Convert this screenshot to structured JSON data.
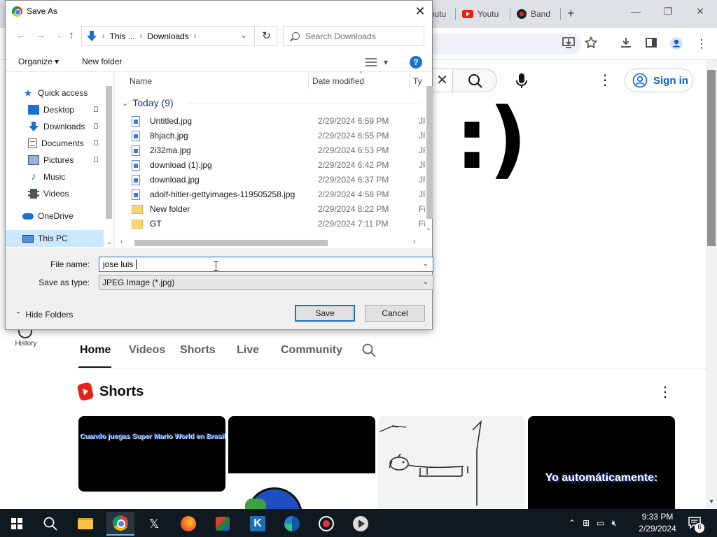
{
  "chrome": {
    "tabs": [
      {
        "label": "outu"
      },
      {
        "label": "Youtu"
      },
      {
        "label": "Band"
      }
    ],
    "new_tab": "+",
    "minimize": "—",
    "restore": "❐",
    "close": "✕"
  },
  "youtube": {
    "search_clear": "✕",
    "sign_in": "Sign in",
    "banner_text": ":)",
    "history_label": "History",
    "channel_tabs": [
      "Home",
      "Videos",
      "Shorts",
      "Live",
      "Community"
    ],
    "shorts_title": "Shorts",
    "shorts_more": "⋮",
    "shorts": [
      {
        "caption": "Cuando juegas Super Mario World en Brasil"
      },
      {
        "caption": ""
      },
      {
        "caption": ""
      },
      {
        "caption": "Yo automáticamente:"
      }
    ]
  },
  "dialog": {
    "title": "Save As",
    "close": "✕",
    "address": {
      "segments": [
        "This ...",
        "Downloads"
      ]
    },
    "search_placeholder": "Search Downloads",
    "organize": "Organize ▾",
    "new_folder": "New folder",
    "help": "?",
    "nav_items": [
      {
        "label": "Quick access",
        "icon": "star-icon"
      },
      {
        "label": "Desktop",
        "icon": "desktop-icon",
        "pinned": true
      },
      {
        "label": "Downloads",
        "icon": "download-icon",
        "pinned": true
      },
      {
        "label": "Documents",
        "icon": "document-icon",
        "pinned": true
      },
      {
        "label": "Pictures",
        "icon": "pictures-icon",
        "pinned": true
      },
      {
        "label": "Music",
        "icon": "music-icon"
      },
      {
        "label": "Videos",
        "icon": "videos-icon"
      },
      {
        "label": "OneDrive",
        "icon": "cloud-icon"
      },
      {
        "label": "This PC",
        "icon": "computer-icon",
        "selected": true
      }
    ],
    "columns": {
      "name": "Name",
      "date": "Date modified",
      "type": "Ty"
    },
    "group_label": "Today (9)",
    "files": [
      {
        "name": "Untitled.jpg",
        "date": "2/29/2024 6:59 PM",
        "type": "JP",
        "kind": "image"
      },
      {
        "name": "8hjach.jpg",
        "date": "2/29/2024 6:55 PM",
        "type": "JP",
        "kind": "image"
      },
      {
        "name": "2i32ma.jpg",
        "date": "2/29/2024 6:53 PM",
        "type": "JP",
        "kind": "image"
      },
      {
        "name": "download (1).jpg",
        "date": "2/29/2024 6:42 PM",
        "type": "JP",
        "kind": "image"
      },
      {
        "name": "download.jpg",
        "date": "2/29/2024 6:37 PM",
        "type": "JP",
        "kind": "image"
      },
      {
        "name": "adolf-hitler-gettyimages-119505258.jpg",
        "date": "2/29/2024 4:58 PM",
        "type": "JP",
        "kind": "image"
      },
      {
        "name": "New folder",
        "date": "2/29/2024 8:22 PM",
        "type": "Fi",
        "kind": "folder"
      },
      {
        "name": "GT",
        "date": "2/29/2024 7:11 PM",
        "type": "Fi",
        "kind": "folder"
      }
    ],
    "file_name_label": "File name:",
    "file_name_value": "jose luis ",
    "save_type_label": "Save as type:",
    "save_type_value": "JPEG Image (*.jpg)",
    "hide_folders": "Hide Folders",
    "save": "Save",
    "cancel": "Cancel"
  },
  "taskbar": {
    "clock_time": "9:33 PM",
    "clock_date": "2/29/2024",
    "notifications_count": "6"
  }
}
